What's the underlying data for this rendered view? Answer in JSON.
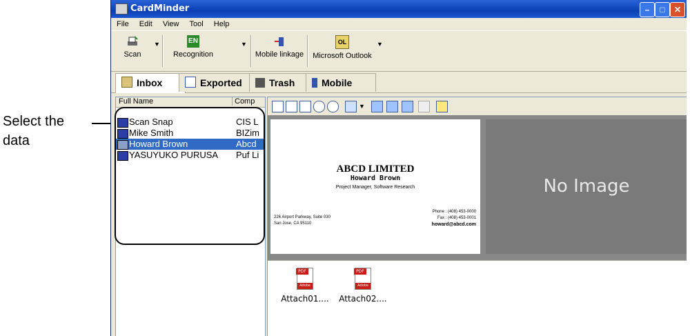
{
  "callout": {
    "line1": "Select the",
    "line2": "data"
  },
  "window": {
    "title": "CardMinder"
  },
  "menu": [
    "File",
    "Edit",
    "View",
    "Tool",
    "Help"
  ],
  "toolbar": {
    "scan": "Scan",
    "recognition": "Recognition",
    "mobile_linkage": "Mobile linkage",
    "outlook": "Microsoft Outlook",
    "recognition_badge": "EN",
    "outlook_badge": "OL"
  },
  "tabs": [
    {
      "label": "Inbox"
    },
    {
      "label": "Exported"
    },
    {
      "label": "Trash"
    },
    {
      "label": "Mobile"
    }
  ],
  "list": {
    "columns": [
      "Full Name",
      "Comp"
    ],
    "rows": [
      {
        "name": "Scan Snap",
        "company": "CIS L"
      },
      {
        "name": "Mike Smith",
        "company": "BIZim"
      },
      {
        "name": "Howard Brown",
        "company": "Abcd"
      },
      {
        "name": "YASUYUKO PURUSA",
        "company": "Puf Li"
      }
    ],
    "selected_index": 2
  },
  "card": {
    "company": "ABCD LIMITED",
    "name": "Howard Brown",
    "role": "Project Manager, Software Research",
    "address1": "226 Airport Parkway, Suite 030",
    "address2": "San Jose, CA 95110",
    "phone": "Phone : (408) 453-0000",
    "fax": "Fax : (408) 453-0001",
    "email": "howard@abcd.com"
  },
  "no_image": "No Image",
  "attachments": [
    "Attach01....",
    "Attach02...."
  ],
  "pdf_label": "PDF",
  "adobe_label": "Adobe",
  "colors": {
    "title_bar": "#0a3fb5",
    "selection": "#316ac5",
    "image_bg": "#7a7a7a"
  }
}
